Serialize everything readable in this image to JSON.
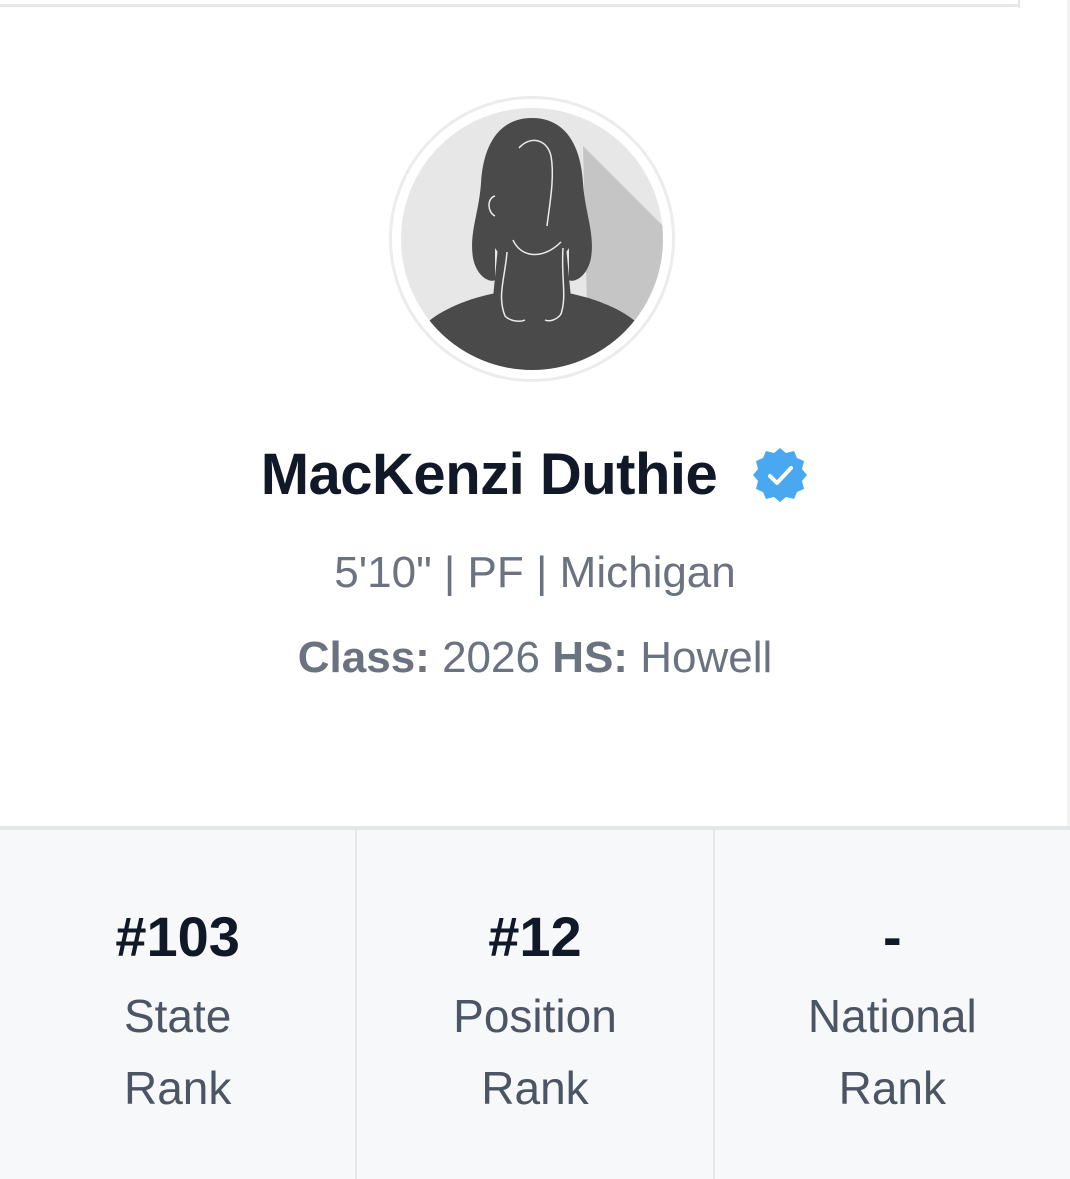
{
  "player": {
    "name": "MacKenzi Duthie",
    "verified": true,
    "meta": "5'10\" | PF | Michigan",
    "class_label": "Class:",
    "class_value": "2026",
    "hs_label": "HS:",
    "hs_value": "Howell"
  },
  "ranks": [
    {
      "value": "#103",
      "label_line1": "State",
      "label_line2": "Rank"
    },
    {
      "value": "#12",
      "label_line1": "Position",
      "label_line2": "Rank"
    },
    {
      "value": "-",
      "label_line1": "National",
      "label_line2": "Rank"
    }
  ],
  "colors": {
    "verified_badge": "#4aa8f0",
    "name_text": "#111827",
    "meta_text": "#6b7280",
    "silhouette": "#4a4a4a",
    "rank_background": "#f7f8fa"
  }
}
